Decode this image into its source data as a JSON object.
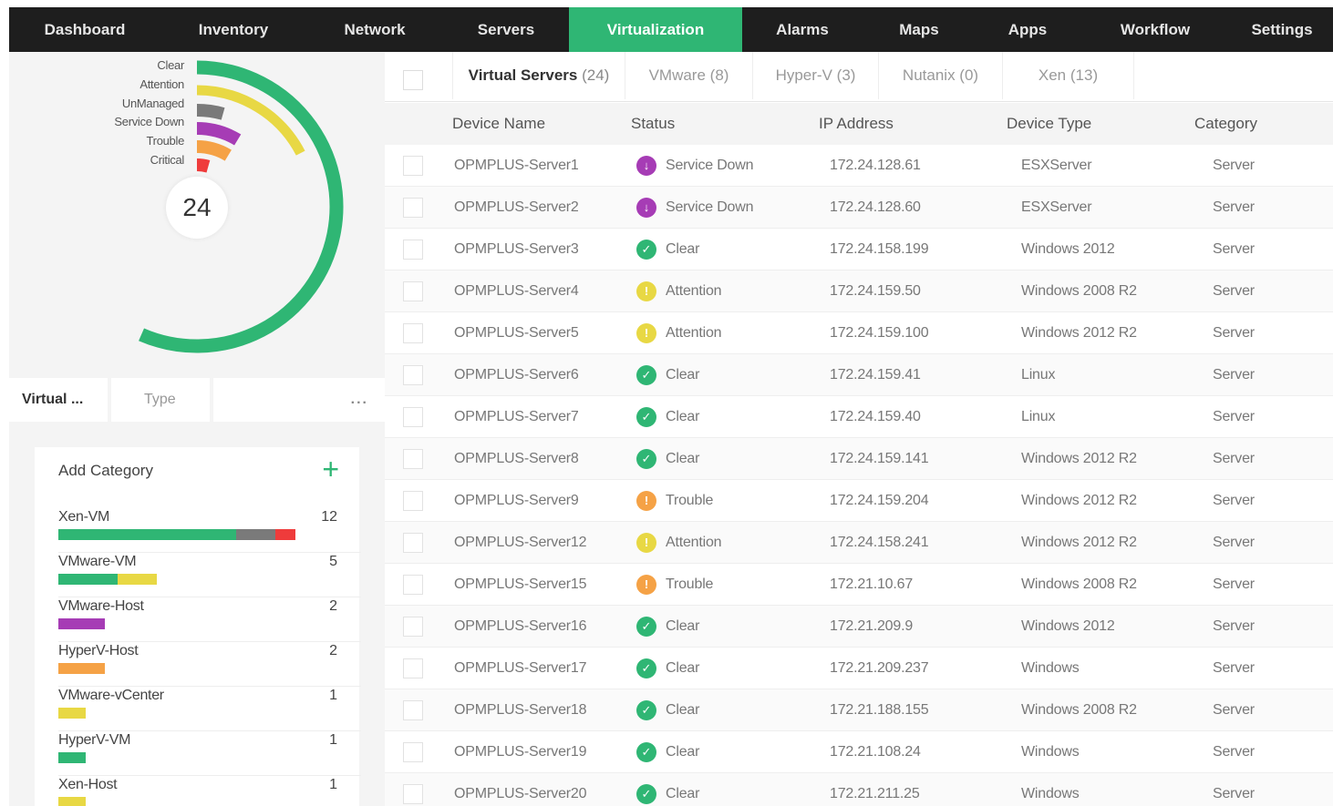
{
  "nav": {
    "items": [
      "Dashboard",
      "Inventory",
      "Network",
      "Servers",
      "Virtualization",
      "Alarms",
      "Maps",
      "Apps",
      "Workflow",
      "Settings"
    ],
    "active": "Virtualization"
  },
  "summary": {
    "total": "24",
    "legend": [
      {
        "label": "Clear",
        "color": "#2fb674",
        "value": 13
      },
      {
        "label": "Attention",
        "color": "#e8d844",
        "value": 4
      },
      {
        "label": "UnManaged",
        "color": "#7a7a7a",
        "value": 1
      },
      {
        "label": "Service Down",
        "color": "#a63cb5",
        "value": 2
      },
      {
        "label": "Trouble",
        "color": "#f5a246",
        "value": 2
      },
      {
        "label": "Critical",
        "color": "#ef3b3b",
        "value": 1
      }
    ]
  },
  "left_tabs": {
    "virtual": "Virtual ...",
    "type": "Type",
    "more": "..."
  },
  "categories": {
    "add_label": "Add Category",
    "add_icon": "plus-icon",
    "items": [
      {
        "name": "Xen-VM",
        "count": "12",
        "segments": [
          {
            "color": "#2fb674",
            "value": 9
          },
          {
            "color": "#7a7a7a",
            "value": 2
          },
          {
            "color": "#ef3b3b",
            "value": 1
          }
        ]
      },
      {
        "name": "VMware-VM",
        "count": "5",
        "segments": [
          {
            "color": "#2fb674",
            "value": 3
          },
          {
            "color": "#e8d844",
            "value": 2
          }
        ]
      },
      {
        "name": "VMware-Host",
        "count": "2",
        "segments": [
          {
            "color": "#a63cb5",
            "value": 2
          }
        ]
      },
      {
        "name": "HyperV-Host",
        "count": "2",
        "segments": [
          {
            "color": "#f5a246",
            "value": 2
          }
        ]
      },
      {
        "name": "VMware-vCenter",
        "count": "1",
        "segments": [
          {
            "color": "#e8d844",
            "value": 1
          }
        ]
      },
      {
        "name": "HyperV-VM",
        "count": "1",
        "segments": [
          {
            "color": "#2fb674",
            "value": 1
          }
        ]
      },
      {
        "name": "Xen-Host",
        "count": "1",
        "segments": [
          {
            "color": "#e8d844",
            "value": 1
          }
        ]
      }
    ]
  },
  "tabs": [
    {
      "label": "Virtual Servers",
      "count": "(24)",
      "active": true
    },
    {
      "label": "VMware",
      "count": "(8)",
      "active": false
    },
    {
      "label": "Hyper-V",
      "count": "(3)",
      "active": false
    },
    {
      "label": "Nutanix",
      "count": "(0)",
      "active": false
    },
    {
      "label": "Xen",
      "count": "(13)",
      "active": false
    }
  ],
  "table": {
    "headers": [
      "Device Name",
      "Status",
      "IP Address",
      "Device Type",
      "Category"
    ],
    "status_colors": {
      "Clear": "#2fb674",
      "Attention": "#e8d844",
      "Service Down": "#a63cb5",
      "Trouble": "#f5a246"
    },
    "rows": [
      {
        "name": "OPMPLUS-Server1",
        "status": "Service Down",
        "ip": "172.24.128.61",
        "type": "ESXServer",
        "category": "Server"
      },
      {
        "name": "OPMPLUS-Server2",
        "status": "Service Down",
        "ip": "172.24.128.60",
        "type": "ESXServer",
        "category": "Server"
      },
      {
        "name": "OPMPLUS-Server3",
        "status": "Clear",
        "ip": "172.24.158.199",
        "type": "Windows 2012",
        "category": "Server"
      },
      {
        "name": "OPMPLUS-Server4",
        "status": "Attention",
        "ip": "172.24.159.50",
        "type": "Windows 2008 R2",
        "category": "Server"
      },
      {
        "name": "OPMPLUS-Server5",
        "status": "Attention",
        "ip": "172.24.159.100",
        "type": "Windows 2012 R2",
        "category": "Server"
      },
      {
        "name": "OPMPLUS-Server6",
        "status": "Clear",
        "ip": "172.24.159.41",
        "type": "Linux",
        "category": "Server"
      },
      {
        "name": "OPMPLUS-Server7",
        "status": "Clear",
        "ip": "172.24.159.40",
        "type": "Linux",
        "category": "Server"
      },
      {
        "name": "OPMPLUS-Server8",
        "status": "Clear",
        "ip": "172.24.159.141",
        "type": "Windows 2012 R2",
        "category": "Server"
      },
      {
        "name": "OPMPLUS-Server9",
        "status": "Trouble",
        "ip": "172.24.159.204",
        "type": "Windows 2012 R2",
        "category": "Server"
      },
      {
        "name": "OPMPLUS-Server12",
        "status": "Attention",
        "ip": "172.24.158.241",
        "type": "Windows 2012 R2",
        "category": "Server"
      },
      {
        "name": "OPMPLUS-Server15",
        "status": "Trouble",
        "ip": "172.21.10.67",
        "type": "Windows 2008 R2",
        "category": "Server"
      },
      {
        "name": "OPMPLUS-Server16",
        "status": "Clear",
        "ip": "172.21.209.9",
        "type": "Windows 2012",
        "category": "Server"
      },
      {
        "name": "OPMPLUS-Server17",
        "status": "Clear",
        "ip": "172.21.209.237",
        "type": "Windows",
        "category": "Server"
      },
      {
        "name": "OPMPLUS-Server18",
        "status": "Clear",
        "ip": "172.21.188.155",
        "type": "Windows 2008 R2",
        "category": "Server"
      },
      {
        "name": "OPMPLUS-Server19",
        "status": "Clear",
        "ip": "172.21.108.24",
        "type": "Windows",
        "category": "Server"
      },
      {
        "name": "OPMPLUS-Server20",
        "status": "Clear",
        "ip": "172.21.211.25",
        "type": "Windows",
        "category": "Server"
      }
    ]
  }
}
